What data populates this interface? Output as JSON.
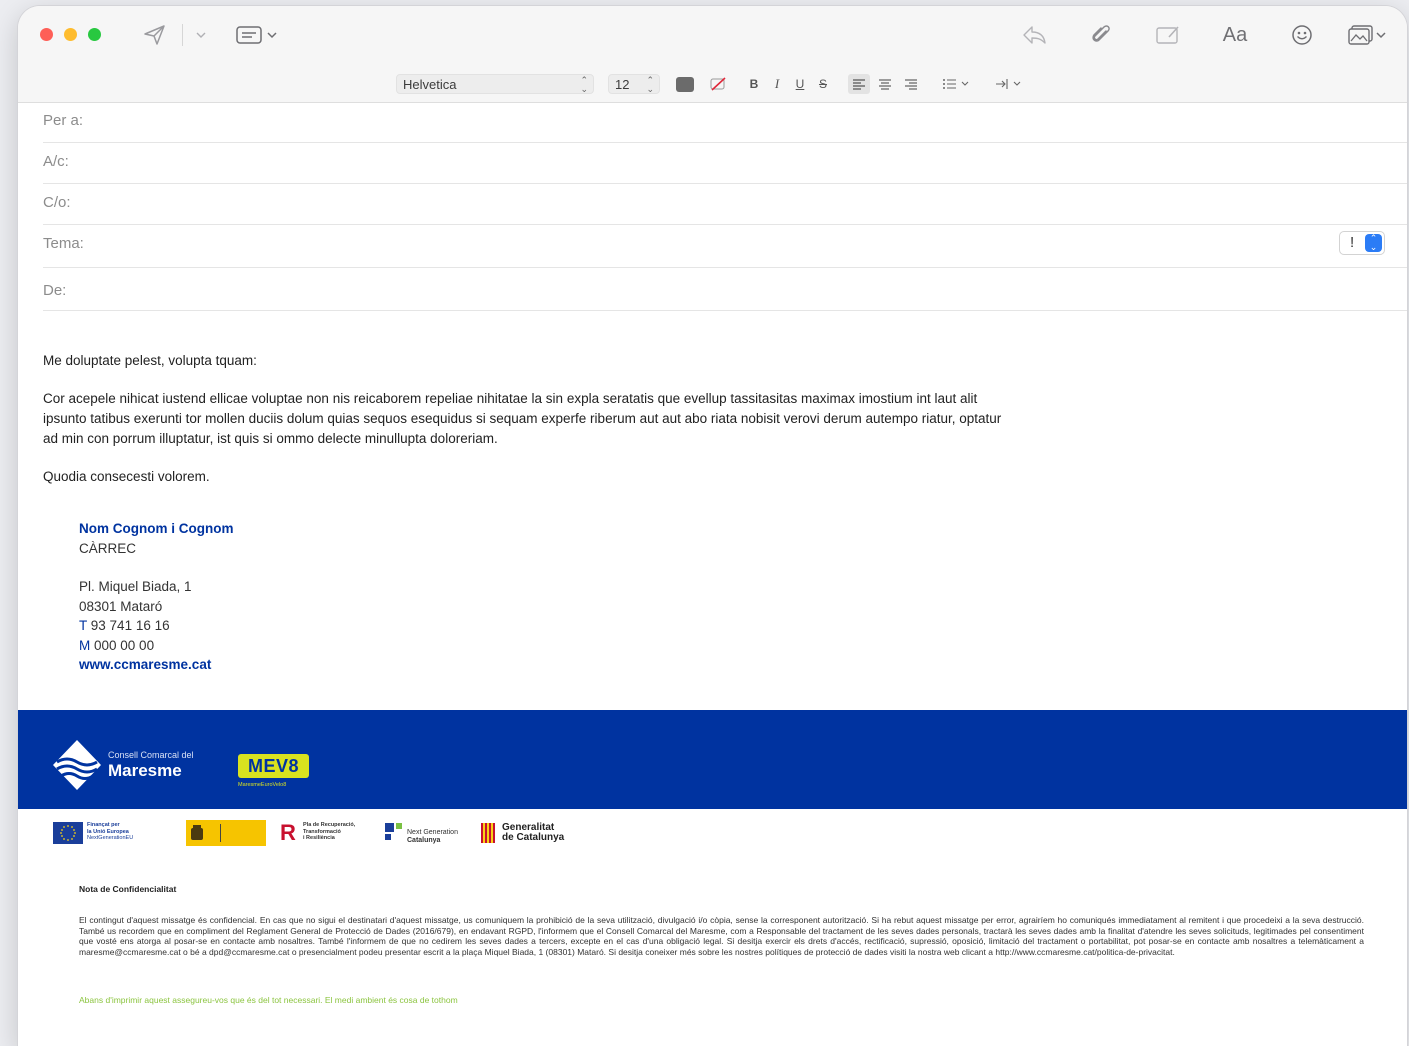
{
  "toolbar": {
    "icons": [
      "send-icon",
      "chevron-down-icon",
      "header-fields-icon",
      "reply-icon",
      "attachment-icon",
      "markup-icon",
      "format-icon",
      "emoji-icon",
      "photo-browser-icon"
    ],
    "format_label": "Aa"
  },
  "format_bar": {
    "font": "Helvetica",
    "size": "12",
    "bold": "B",
    "italic": "I",
    "underline": "U",
    "strike": "S"
  },
  "fields": {
    "to": "Per a:",
    "cc": "A/c:",
    "bcc": "C/o:",
    "subject": "Tema:",
    "from": "De:",
    "priority": "!"
  },
  "body": {
    "greeting": "Me doluptate pelest, volupta tquam:",
    "paragraph": "Cor acepele nihicat iustend ellicae voluptae non nis reicaborem repeliae nihitatae la sin expla seratatis que evellup tassitasitas maximax imostium int laut alit ipsunto tatibus exerunti tor mollen duciis dolum quias sequos esequidus si sequam experfe riberum aut aut abo riata nobisit verovi derum autempo riatur, optatur ad min con porrum illuptatur, ist quis si ommo delecte minullupta doloreriam.",
    "closing": "Quodia consecesti volorem."
  },
  "signature": {
    "name": "Nom Cognom i Cognom",
    "role": "CÀRREC",
    "address1": "Pl. Miquel Biada, 1",
    "address2": "08301 Mataró",
    "phone_label": "T",
    "phone": "93 741 16 16",
    "mobile_label": "M",
    "mobile": "000 00 00",
    "web": "www.ccmaresme.cat"
  },
  "banner": {
    "consell_small": "Consell Comarcal del",
    "consell_big": "Maresme",
    "mev": "MEV8",
    "mev_sub": "MaresmeEuroVelo8"
  },
  "funders": {
    "eu_line1": "Finançat per",
    "eu_line2": "la Unió Europea",
    "eu_line3": "NextGenerationEU",
    "prtr_line1": "Pla de Recuperació,",
    "prtr_line2": "Transformació",
    "prtr_line3": "i Resiliència",
    "ngc_line1": "Next Generation",
    "ngc_line2": "Catalunya",
    "gen_line1": "Generalitat",
    "gen_line2": "de Catalunya"
  },
  "confidentiality": {
    "title": "Nota de Confidencialitat",
    "text": "El contingut d'aquest missatge és confidencial. En cas que no sigui el destinatari d'aquest missatge, us comuniquem la prohibició de la seva utilització, divulgació i/o còpia, sense la corresponent autorització. Si ha rebut aquest missatge per error, agrairíem ho comuniqués immediatament al remitent i que procedeixi a la seva destrucció. També us recordem que en compliment del Reglament General de Protecció de Dades (2016/679), en endavant RGPD, l'informem que el Consell Comarcal del Maresme, com a Responsable del tractament de les seves dades personals, tractarà les seves dades amb la finalitat d'atendre les seves solicituds, legitimades pel consentiment que vosté ens atorga al posar-se en contacte amb nosaltres. També l'informem de que no cedirem les seves dades a tercers, excepte en el cas d'una obligació legal. Si desitja exercir els drets d'accés, rectificació, supressió, oposició, limitació del tractament o portabilitat, pot posar-se en contacte amb nosaltres a telemàticament a  maresme@ccmaresme.cat o bé a dpd@ccmaresme.cat o presencialment podeu presentar escrit a la  plaça Miquel Biada, 1 (08301) Mataró. Si desitja coneixer més sobre les nostres polítiques de protecció de dades visiti la nostra web clicant a http://www.ccmaresme.cat/politica-de-privacitat.",
    "eco": "Abans d'imprimir aquest assegureu-vos que és del tot necessari. El medi ambient és cosa de tothom"
  },
  "colors": {
    "brand_blue": "#0033a0",
    "mev_yellow": "#d9e21f",
    "eco_green": "#8bc43f",
    "accent": "#2b7cf6"
  }
}
